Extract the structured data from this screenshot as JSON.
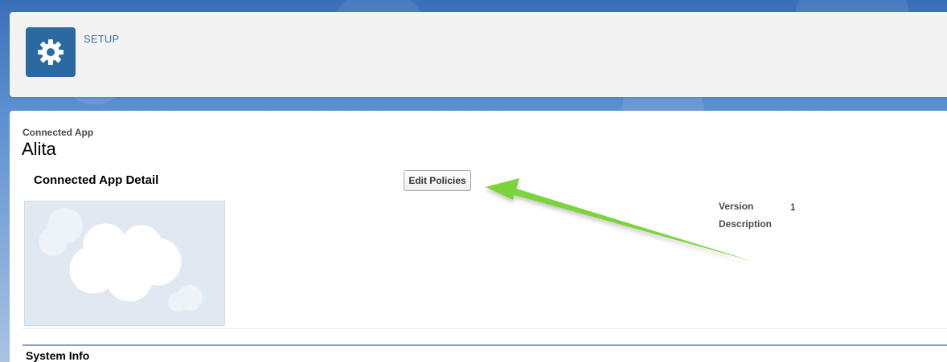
{
  "header": {
    "app_label": "SETUP",
    "icon": "gear-icon",
    "tile_color": "#2b6aa0"
  },
  "page": {
    "breadcrumb": "Connected App",
    "title": "Alita",
    "section_title": "Connected App Detail",
    "edit_button_label": "Edit Policies",
    "logo_icon": "cloud-icon",
    "details": [
      {
        "label": "Version",
        "value": "1"
      },
      {
        "label": "Description",
        "value": ""
      }
    ],
    "system_section_title": "System Info"
  },
  "annotation": {
    "arrow_color": "#7dd33a"
  }
}
